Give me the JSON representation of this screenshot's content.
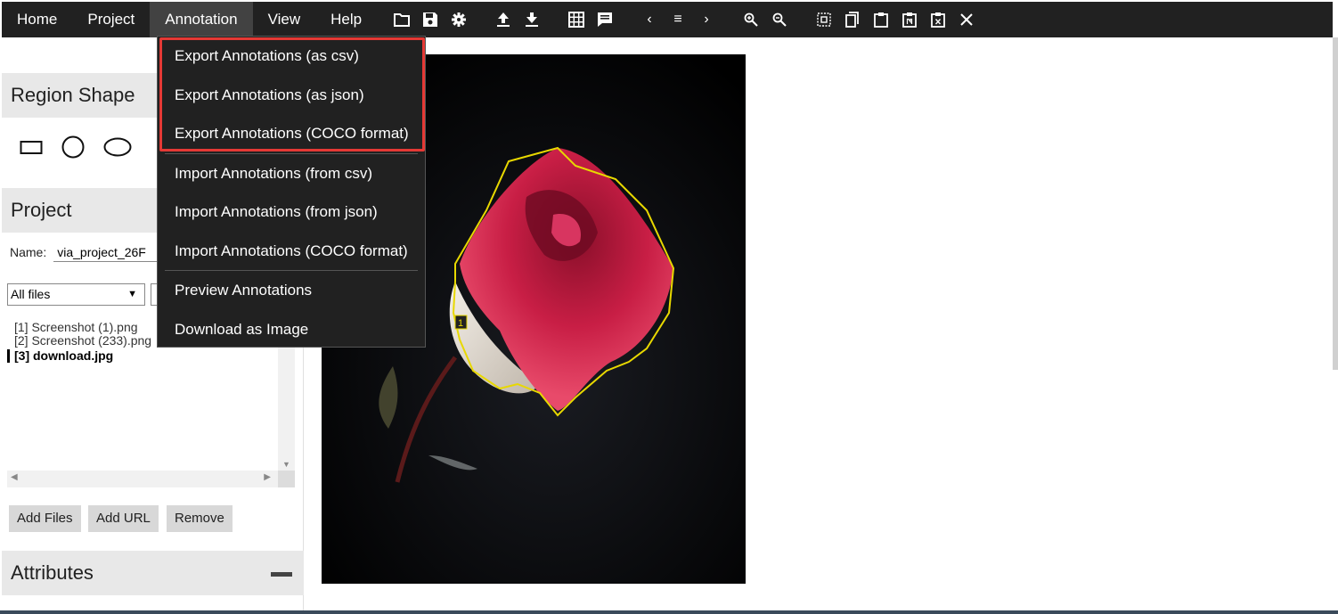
{
  "menubar": {
    "items": [
      {
        "label": "Home"
      },
      {
        "label": "Project"
      },
      {
        "label": "Annotation"
      },
      {
        "label": "View"
      },
      {
        "label": "Help"
      }
    ],
    "active_index": 2,
    "toolbar_icons": [
      "folder-icon",
      "save-icon",
      "settings-icon",
      "upload-icon",
      "download-icon",
      "grid-icon",
      "comment-icon",
      "chevron-left-icon",
      "list-icon",
      "chevron-right-icon",
      "zoom-in-icon",
      "zoom-out-icon",
      "select-all-icon",
      "copy-icon",
      "paste-icon",
      "paste-n-icon",
      "delete-x-icon",
      "close-icon"
    ]
  },
  "annotation_menu": {
    "items": [
      {
        "label": "Export Annotations (as csv)"
      },
      {
        "label": "Export Annotations (as json)"
      },
      {
        "label": "Export Annotations (COCO format)"
      },
      {
        "label": "Import Annotations (from csv)"
      },
      {
        "label": "Import Annotations (from json)"
      },
      {
        "label": "Import Annotations (COCO format)"
      },
      {
        "label": "Preview Annotations"
      },
      {
        "label": "Download as Image"
      }
    ],
    "highlight_color": "#e53935"
  },
  "left_panel": {
    "region_shape": {
      "title": "Region Shape",
      "shapes": [
        "rectangle-icon",
        "circle-icon",
        "ellipse-icon"
      ]
    },
    "project": {
      "title": "Project",
      "name_label": "Name:",
      "name_value": "via_project_26F",
      "filter_value": "All files",
      "files": [
        {
          "label": "[1] Screenshot (1).png"
        },
        {
          "label": "[2] Screenshot (233).png"
        },
        {
          "label": "[3] download.jpg"
        }
      ],
      "current_file_index": 2,
      "buttons": {
        "add_files": "Add Files",
        "add_url": "Add URL",
        "remove": "Remove"
      }
    },
    "attributes": {
      "title": "Attributes"
    }
  },
  "canvas": {
    "region_label": "1",
    "region_color": "#e8d800"
  }
}
